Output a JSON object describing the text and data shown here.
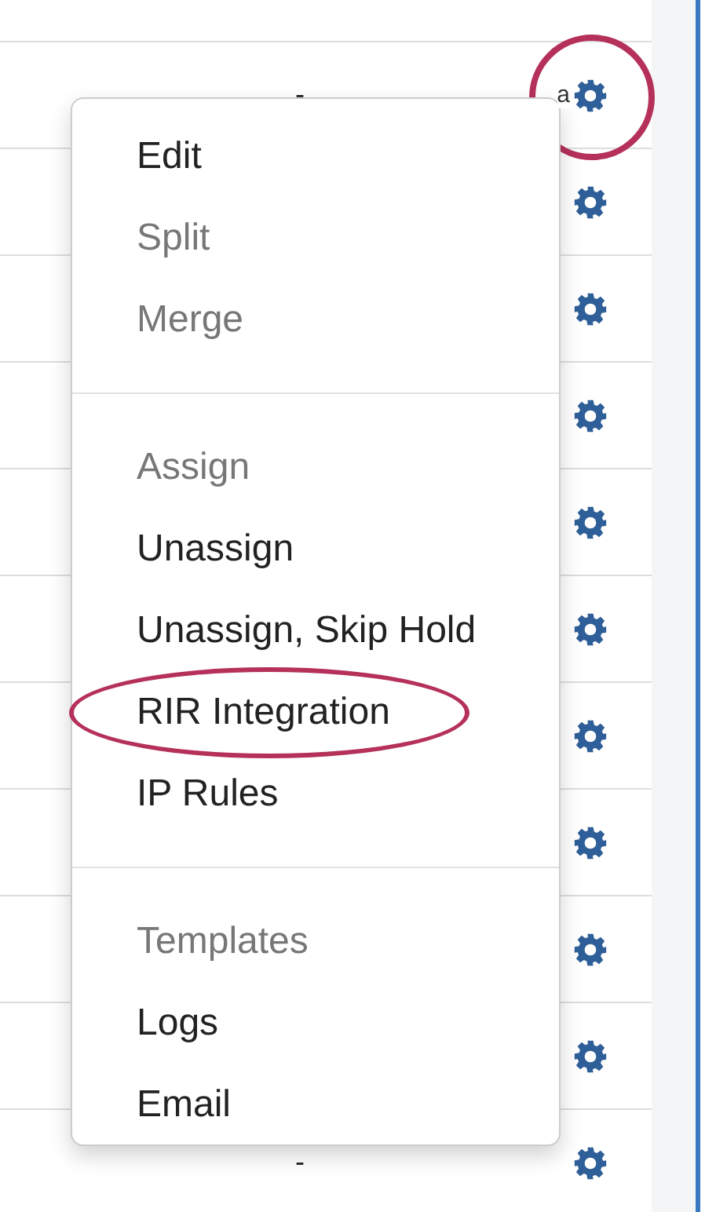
{
  "table": {
    "rows": [
      {
        "value": "-",
        "tag": "a",
        "highlighted": true
      },
      {},
      {},
      {},
      {},
      {},
      {},
      {},
      {},
      {},
      {
        "value": "-"
      }
    ]
  },
  "context_menu": {
    "items": [
      {
        "kind": "item",
        "label": "Edit",
        "disabled": false
      },
      {
        "kind": "item",
        "label": "Split",
        "disabled": true
      },
      {
        "kind": "item",
        "label": "Merge",
        "disabled": true
      },
      {
        "kind": "divider"
      },
      {
        "kind": "item",
        "label": "Assign",
        "disabled": true
      },
      {
        "kind": "item",
        "label": "Unassign",
        "disabled": false
      },
      {
        "kind": "item",
        "label": "Unassign, Skip Hold",
        "disabled": false
      },
      {
        "kind": "item",
        "label": "RIR Integration",
        "disabled": false,
        "highlighted": true
      },
      {
        "kind": "item",
        "label": "IP Rules",
        "disabled": false
      },
      {
        "kind": "divider"
      },
      {
        "kind": "item",
        "label": "Templates",
        "disabled": true
      },
      {
        "kind": "item",
        "label": "Logs",
        "disabled": false
      },
      {
        "kind": "item",
        "label": "Email",
        "disabled": false
      }
    ]
  }
}
